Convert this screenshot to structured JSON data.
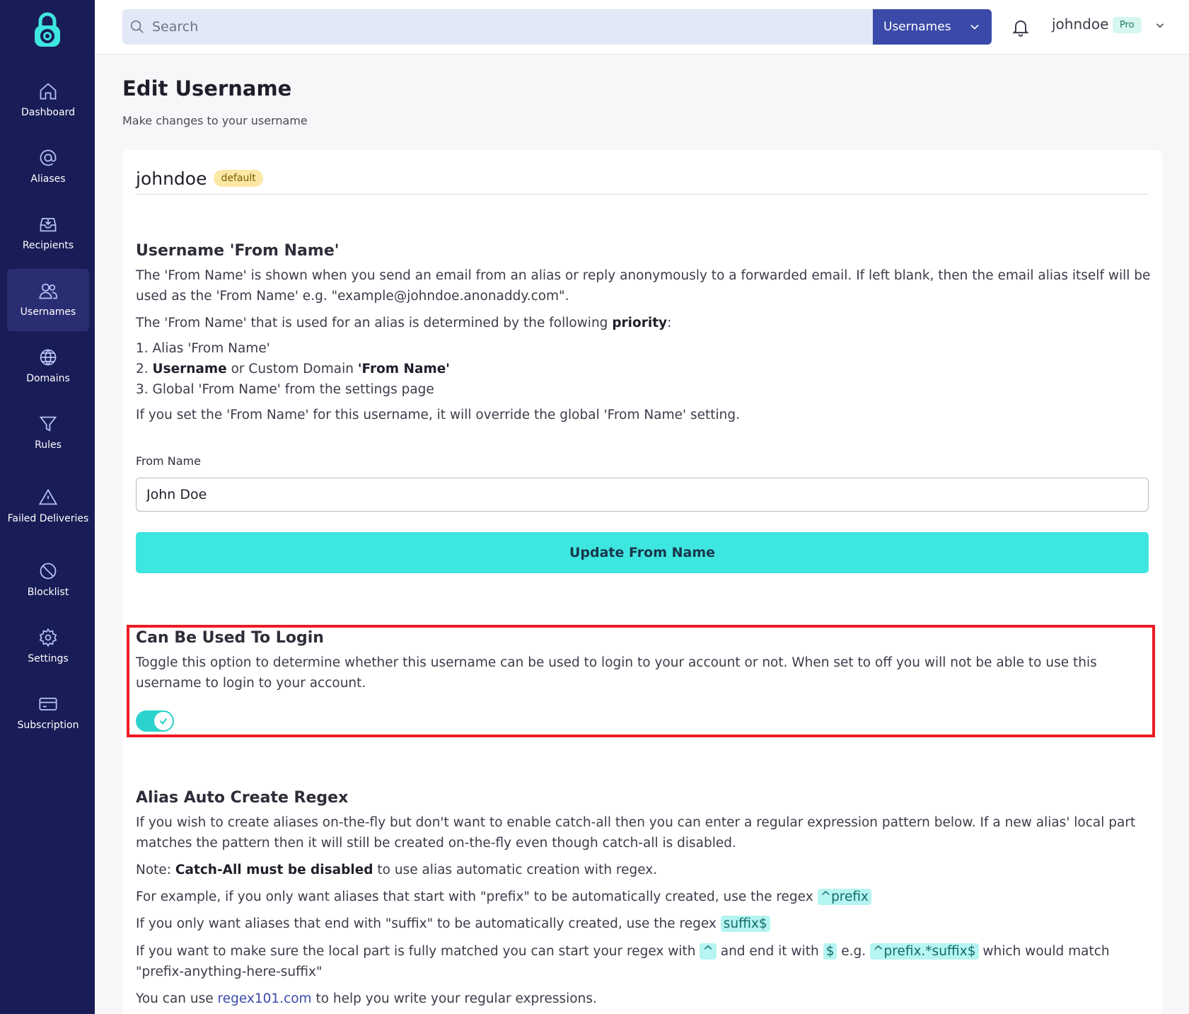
{
  "sidebar": {
    "items": [
      {
        "label": "Dashboard",
        "icon": "home-icon"
      },
      {
        "label": "Aliases",
        "icon": "at-sign-icon"
      },
      {
        "label": "Recipients",
        "icon": "inbox-icon"
      },
      {
        "label": "Usernames",
        "icon": "users-icon",
        "active": true
      },
      {
        "label": "Domains",
        "icon": "globe-icon"
      },
      {
        "label": "Rules",
        "icon": "filter-icon"
      },
      {
        "label": "Failed Deliveries",
        "icon": "warning-icon"
      },
      {
        "label": "Blocklist",
        "icon": "block-icon"
      },
      {
        "label": "Settings",
        "icon": "gear-icon"
      },
      {
        "label": "Subscription",
        "icon": "credit-card-icon"
      }
    ]
  },
  "header": {
    "search_placeholder": "Search",
    "search_scope": "Usernames",
    "username": "johndoe",
    "plan_badge": "Pro"
  },
  "page": {
    "title": "Edit Username",
    "subtitle": "Make changes to your username"
  },
  "card": {
    "name": "johndoe",
    "badge": "default"
  },
  "from_name_section": {
    "title": "Username 'From Name'",
    "p1": "The 'From Name' is shown when you send an email from an alias or reply anonymously to a forwarded email. If left blank, then the email alias itself will be used as the 'From Name' e.g. \"example@johndoe.anonaddy.com\".",
    "p2_prefix": "The 'From Name' that is used for an alias is determined by the following ",
    "p2_bold": "priority",
    "p2_suffix": ":",
    "list_1": "1. Alias 'From Name'",
    "list_2_prefix": "2. ",
    "list_2_bold1": "Username",
    "list_2_mid": " or Custom Domain ",
    "list_2_bold2": "'From Name'",
    "list_3": "3. Global 'From Name' from the settings page",
    "p3": "If you set the 'From Name' for this username, it will override the global 'From Name' setting.",
    "input_label": "From Name",
    "input_value": "John Doe",
    "button_label": "Update From Name"
  },
  "login_section": {
    "title": "Can Be Used To Login",
    "description": "Toggle this option to determine whether this username can be used to login to your account or not. When set to off you will not be able to use this username to login to your account.",
    "toggle_on": true
  },
  "regex_section": {
    "title": "Alias Auto Create Regex",
    "p1": "If you wish to create aliases on-the-fly but don't want to enable catch-all then you can enter a regular expression pattern below. If a new alias' local part matches the pattern then it will still be created on-the-fly even though catch-all is disabled.",
    "note_prefix": "Note: ",
    "note_bold": "Catch-All must be disabled",
    "note_suffix": " to use alias automatic creation with regex.",
    "ex1_text": "For example, if you only want aliases that start with \"prefix\" to be automatically created, use the regex ",
    "ex1_code": "^prefix",
    "ex2_text": "If you only want aliases that end with \"suffix\" to be automatically created, use the regex ",
    "ex2_code": "suffix$",
    "ex3_a": "If you want to make sure the local part is fully matched you can start your regex with ",
    "ex3_code1": "^",
    "ex3_b": " and end it with ",
    "ex3_code2": "$",
    "ex3_c": " e.g. ",
    "ex3_code3": "^prefix.*suffix$",
    "ex3_d": " which would match \"prefix-anything-here-suffix\"",
    "tool_prefix": "You can use ",
    "tool_link": "regex101.com",
    "tool_suffix": " to help you write your regular expressions."
  },
  "colors": {
    "sidebar_bg": "#191d57",
    "accent_teal": "#3ee6e0",
    "primary_blue": "#3b4aa8",
    "highlight_red": "#ec1c24"
  }
}
